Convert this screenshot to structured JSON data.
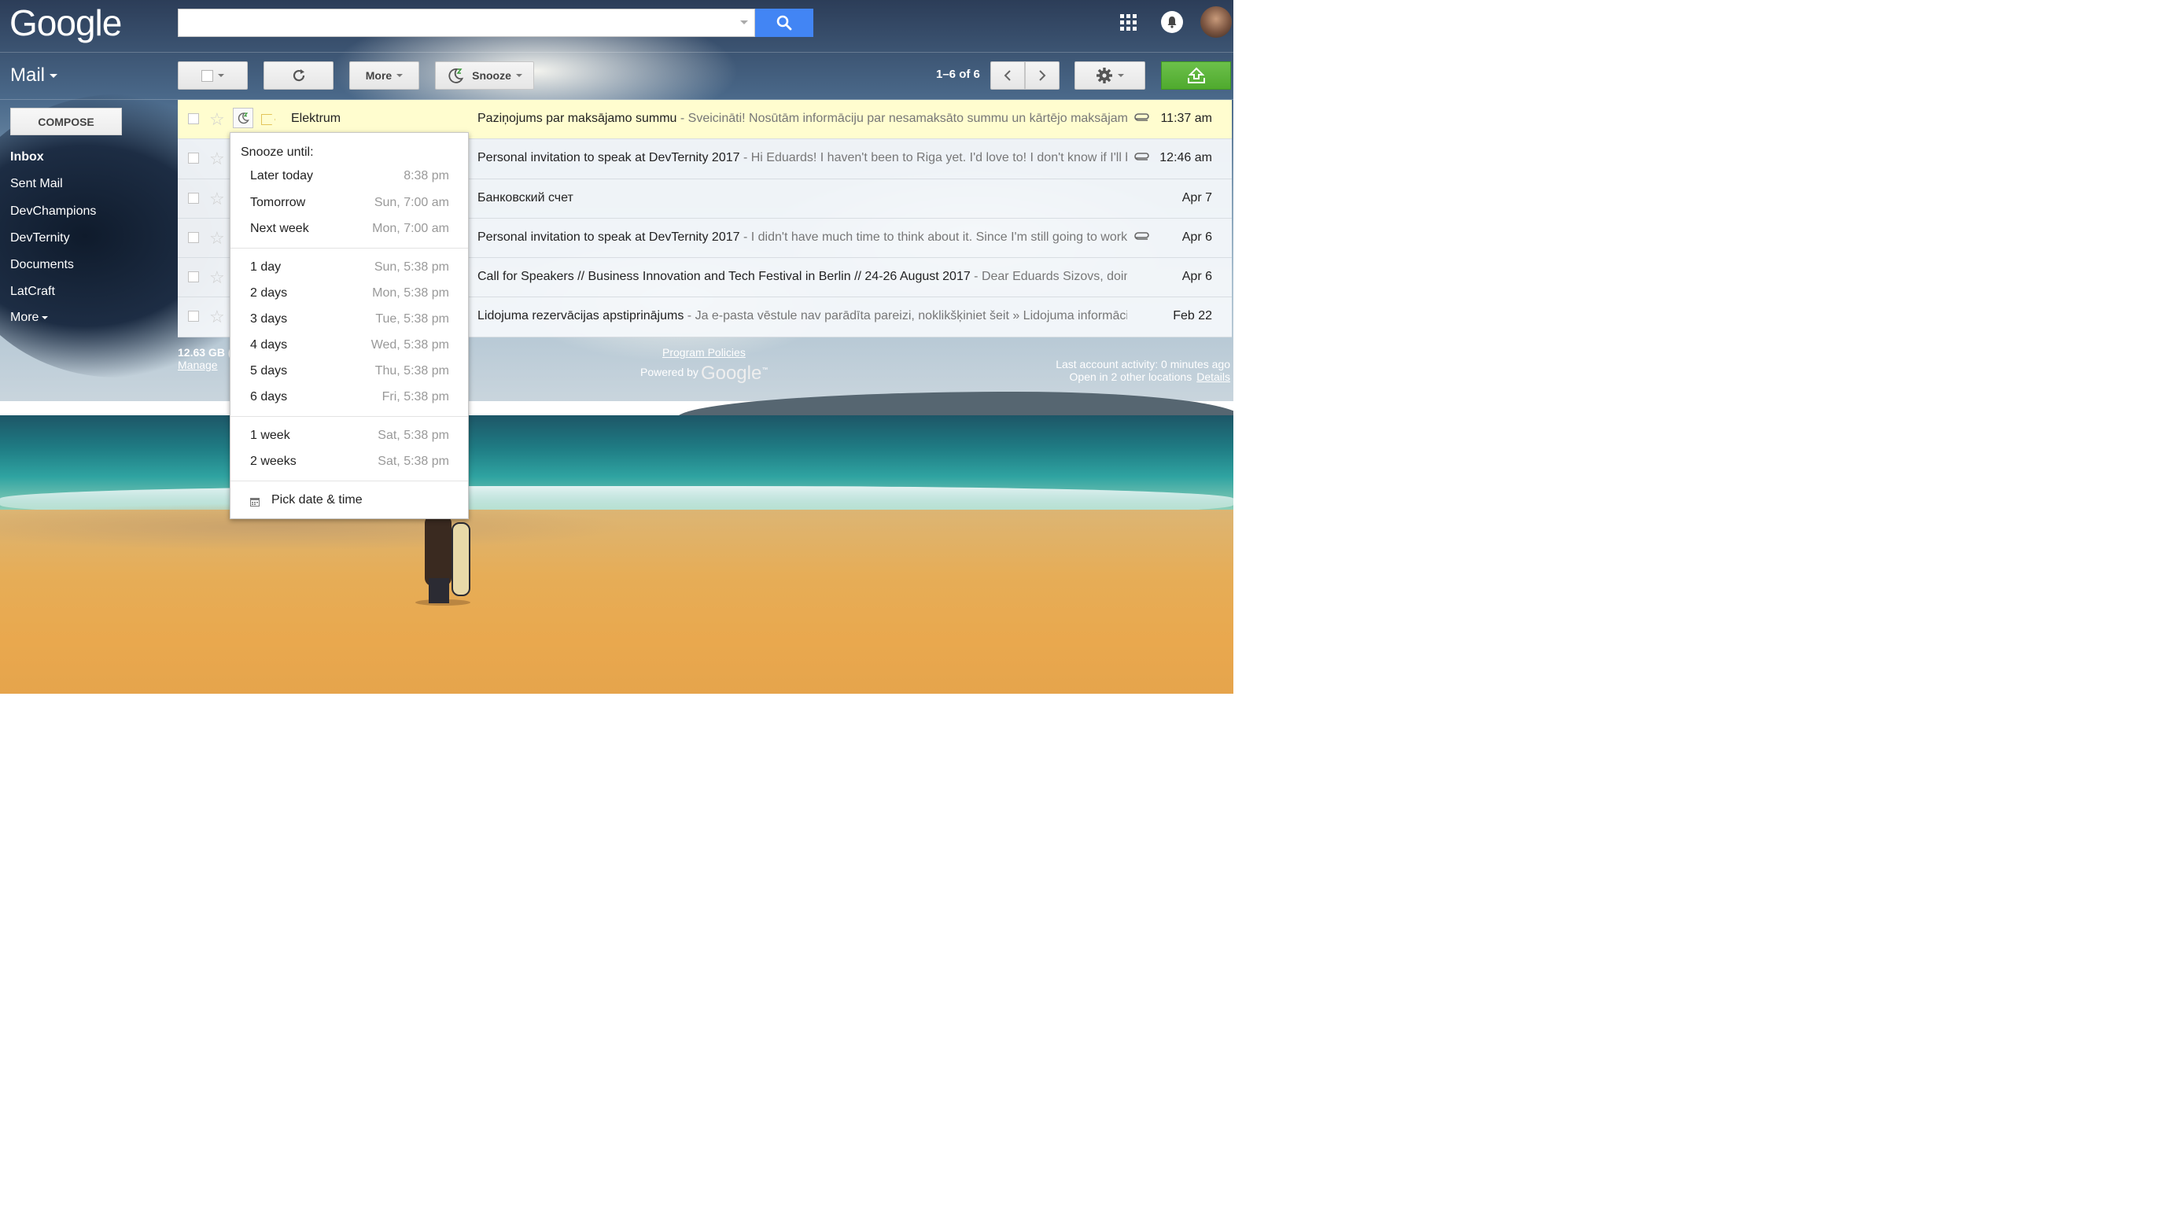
{
  "header": {
    "logo": "Google",
    "search_placeholder": "",
    "search_value": ""
  },
  "toolbar": {
    "mail_label": "Mail",
    "more_label": "More",
    "snooze_label": "Snooze",
    "pager_text": "1–6 of 6"
  },
  "sidebar": {
    "compose_label": "COMPOSE",
    "items": [
      {
        "label": "Inbox"
      },
      {
        "label": "Sent Mail"
      },
      {
        "label": "DevChampions"
      },
      {
        "label": "DevTernity"
      },
      {
        "label": "Documents"
      },
      {
        "label": "LatCraft"
      },
      {
        "label": "More"
      }
    ],
    "storage_text": "12.63 GB (",
    "manage_label": "Manage"
  },
  "emails": [
    {
      "sender": "Elektrum",
      "subject": "Paziņojums par maksājamo summu",
      "snippet": " - Sveicināti! Nosūtām informāciju par nesamaksāto summu un kārtējo maksājamo",
      "date": "11:37 am",
      "attachment": true
    },
    {
      "sender": "",
      "subject": "Personal invitation to speak at DevTernity 2017",
      "snippet": " - Hi Eduards! I haven't been to Riga yet. I'd love to! I don't know if I'll be",
      "date": "12:46 am",
      "attachment": true
    },
    {
      "sender": "",
      "subject": "Банковский счет",
      "snippet": "",
      "date": "Apr 7",
      "attachment": false
    },
    {
      "sender": "",
      "subject": "Personal invitation to speak at DevTernity 2017",
      "snippet": " - I didn't have much time to think about it. Since I'm still going to work",
      "date": "Apr 6",
      "attachment": true
    },
    {
      "sender": "",
      "subject": "Call for Speakers // Business Innovation and Tech Festival in Berlin // 24-26 August 2017",
      "snippet": " - Dear Eduards Sizovs, doin",
      "date": "Apr 6",
      "attachment": false
    },
    {
      "sender": "",
      "subject": "Lidojuma rezervācijas apstiprinājums",
      "snippet": " - Ja e-pasta vēstule nav parādīta pareizi, noklikšķiniet šeit » Lidojuma informācija",
      "date": "Feb 22",
      "attachment": false
    }
  ],
  "snooze_menu": {
    "title": "Snooze until:",
    "groups": [
      [
        {
          "label": "Later today",
          "time": "8:38 pm"
        },
        {
          "label": "Tomorrow",
          "time": "Sun, 7:00 am"
        },
        {
          "label": "Next week",
          "time": "Mon, 7:00 am"
        }
      ],
      [
        {
          "label": "1 day",
          "time": "Sun, 5:38 pm"
        },
        {
          "label": "2 days",
          "time": "Mon, 5:38 pm"
        },
        {
          "label": "3 days",
          "time": "Tue, 5:38 pm"
        },
        {
          "label": "4 days",
          "time": "Wed, 5:38 pm"
        },
        {
          "label": "5 days",
          "time": "Thu, 5:38 pm"
        },
        {
          "label": "6 days",
          "time": "Fri, 5:38 pm"
        }
      ],
      [
        {
          "label": "1 week",
          "time": "Sat, 5:38 pm"
        },
        {
          "label": "2 weeks",
          "time": "Sat, 5:38 pm"
        }
      ]
    ],
    "pick_label": "Pick date & time"
  },
  "footer": {
    "policies_label": "Program Policies",
    "powered_by": "Powered by",
    "powered_logo": "Google",
    "powered_tm": "™",
    "activity_text": "Last account activity: 0 minutes ago",
    "open_locations": "Open in 2 other locations",
    "details_label": "Details"
  },
  "colors": {
    "accent_blue": "#4285f4",
    "upload_green": "#58b334",
    "selected_row": "#fffdcf"
  }
}
